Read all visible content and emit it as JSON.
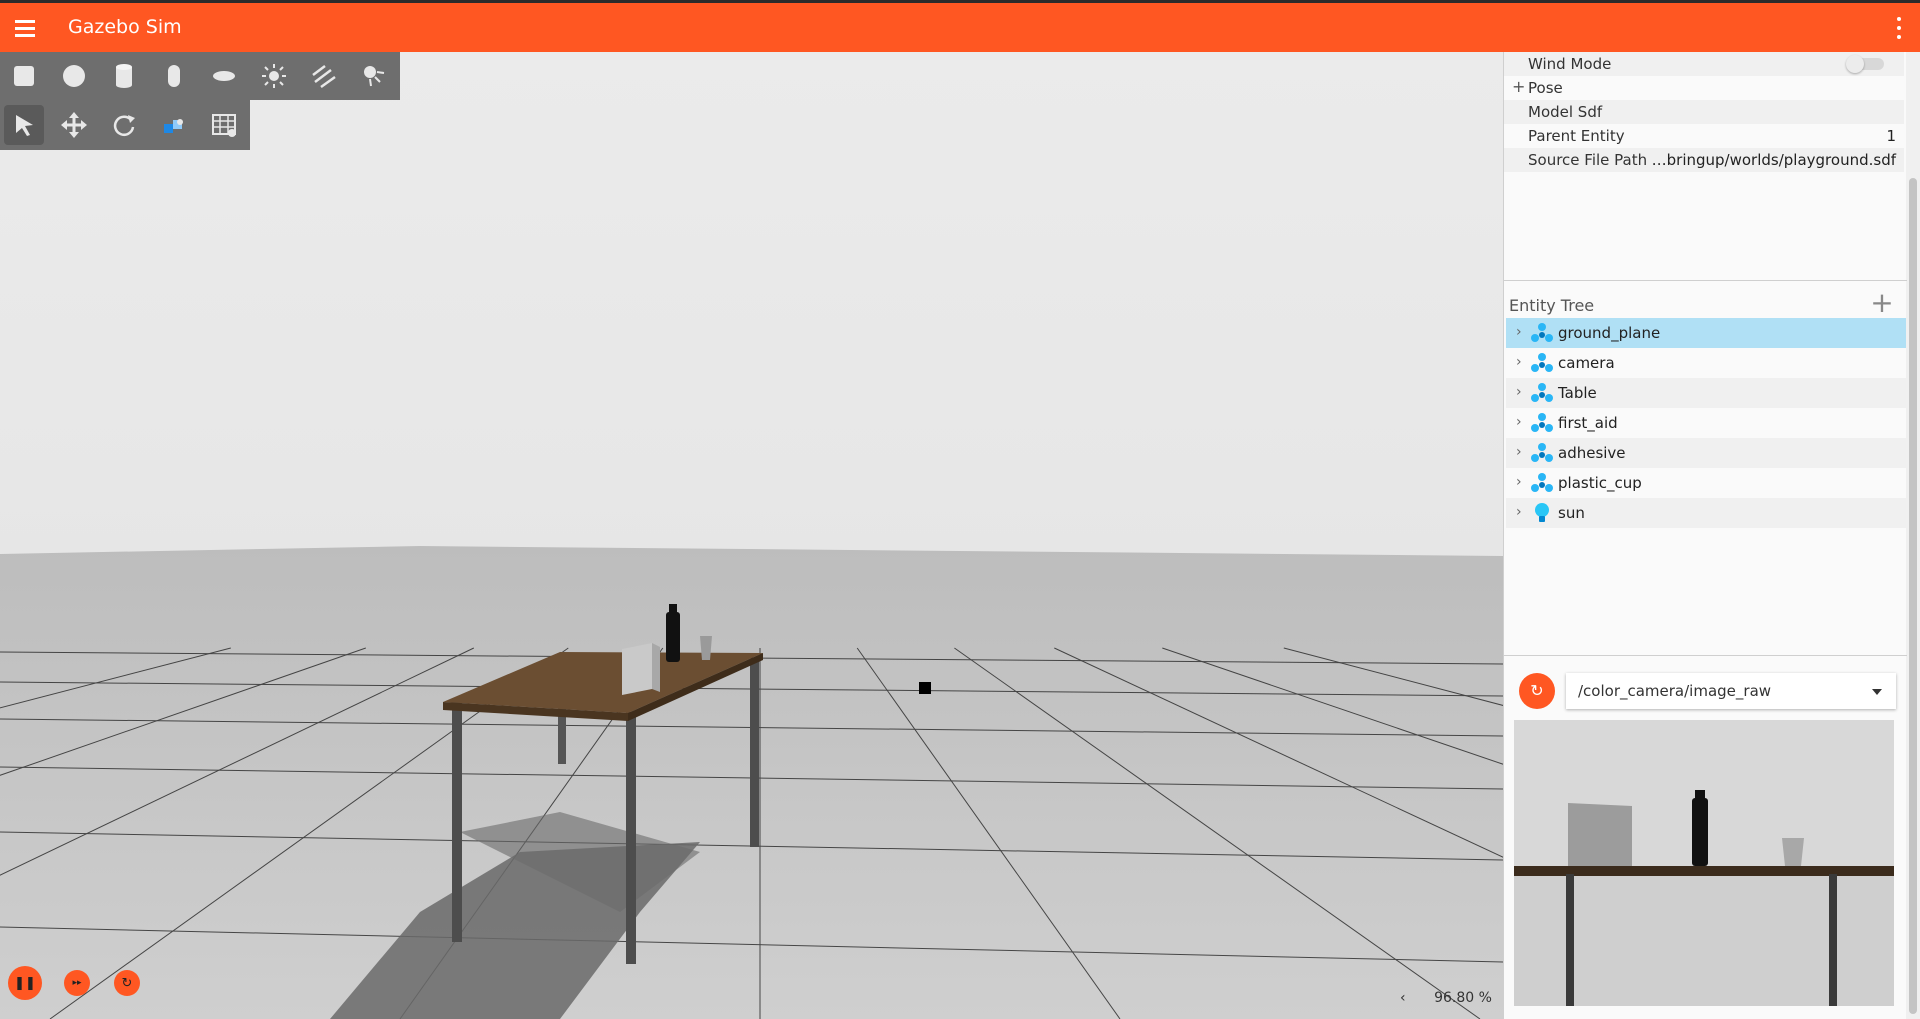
{
  "app": {
    "title": "Gazebo Sim"
  },
  "toolbar": {
    "shapes": [
      {
        "name": "box-shape-icon"
      },
      {
        "name": "sphere-shape-icon"
      },
      {
        "name": "cylinder-shape-icon"
      },
      {
        "name": "capsule-shape-icon"
      },
      {
        "name": "ellipsoid-shape-icon"
      },
      {
        "name": "sun-light-icon"
      },
      {
        "name": "directional-light-icon"
      },
      {
        "name": "spot-light-icon"
      }
    ],
    "tools": [
      {
        "name": "select-tool-icon",
        "active": true
      },
      {
        "name": "translate-tool-icon"
      },
      {
        "name": "rotate-tool-icon"
      },
      {
        "name": "snap-tool-icon"
      },
      {
        "name": "grid-config-icon"
      }
    ]
  },
  "component_inspector": {
    "rows": [
      {
        "label": "Wind Mode",
        "type": "toggle",
        "value": false
      },
      {
        "label": "Pose",
        "type": "expandable"
      },
      {
        "label": "Model Sdf",
        "type": "text",
        "value": ""
      },
      {
        "label": "Parent Entity",
        "type": "text",
        "value": "1"
      },
      {
        "label": "Source File Path",
        "type": "text",
        "value": "…bringup/worlds/playground.sdf"
      }
    ]
  },
  "entity_tree": {
    "title": "Entity Tree",
    "items": [
      {
        "label": "ground_plane",
        "icon": "model-icon",
        "selected": true
      },
      {
        "label": "camera",
        "icon": "model-icon"
      },
      {
        "label": "Table",
        "icon": "model-icon"
      },
      {
        "label": "first_aid",
        "icon": "model-icon"
      },
      {
        "label": "adhesive",
        "icon": "model-icon"
      },
      {
        "label": "plastic_cup",
        "icon": "model-icon"
      },
      {
        "label": "sun",
        "icon": "light-bulb-icon"
      }
    ]
  },
  "image_display": {
    "refresh_glyph": "↻",
    "topic": "/color_camera/image_raw"
  },
  "playback": {
    "play_glyph": "❚❚",
    "step_glyph": "▸▸",
    "reset_glyph": "↻"
  },
  "status": {
    "chevron": "‹",
    "rtf": "96.80 %"
  },
  "colors": {
    "accent": "#ff5722",
    "selection": "#b0e0f5",
    "toolbar": "#6e6e6e",
    "model_icon": "#29b6f6"
  }
}
